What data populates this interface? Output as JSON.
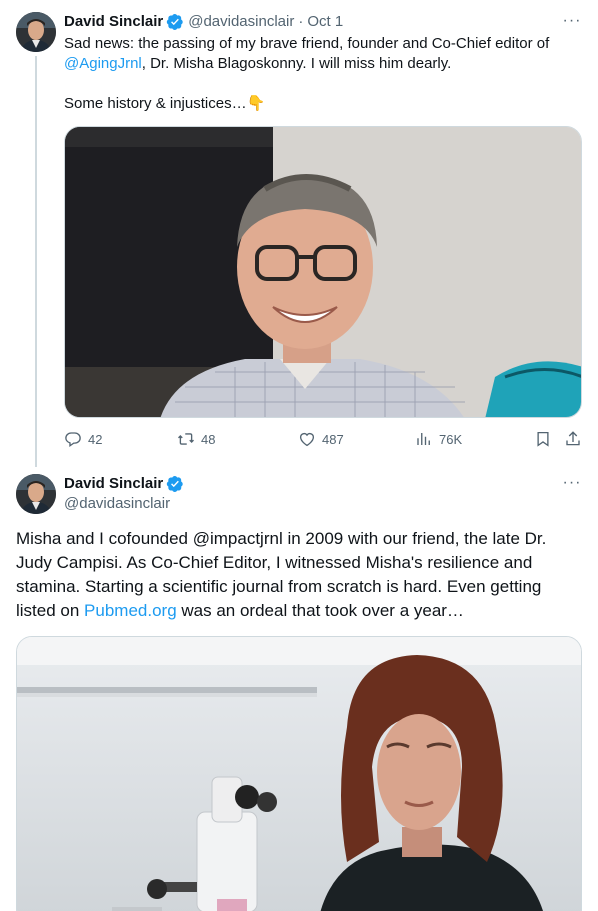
{
  "tweet1": {
    "author_name": "David Sinclair",
    "handle": "@davidasinclair",
    "separator": "·",
    "date": "Oct 1",
    "more_label": "···",
    "text_part1": "Sad news: the passing of my brave friend, founder and Co-Chief editor of ",
    "mention": "@AgingJrnl",
    "text_part2": ", Dr. Misha Blagoskonny. I will miss him dearly.",
    "text_line2": "Some history & injustices…",
    "emoji": "👇",
    "media_icon": "video-call-screenshot",
    "actions": {
      "replies": "42",
      "reposts": "48",
      "likes": "487",
      "views": "76K"
    }
  },
  "tweet2": {
    "author_name": "David Sinclair",
    "handle": "@davidasinclair",
    "more_label": "···",
    "text_part1": "Misha and I cofounded @impactjrnl in 2009 with our friend, the late Dr. Judy Campisi. As Co-Chief Editor, I witnessed Misha's resilience and stamina. Starting a scientific journal from scratch is hard. Even getting listed on ",
    "link": "Pubmed.org",
    "text_part2": " was an ordeal that took over a year…",
    "media_icon": "lab-portrait-photo"
  },
  "colors": {
    "accent": "#1d9bf0",
    "secondary_text": "#536471",
    "primary_text": "#0f1419",
    "border": "#cfd9de"
  }
}
